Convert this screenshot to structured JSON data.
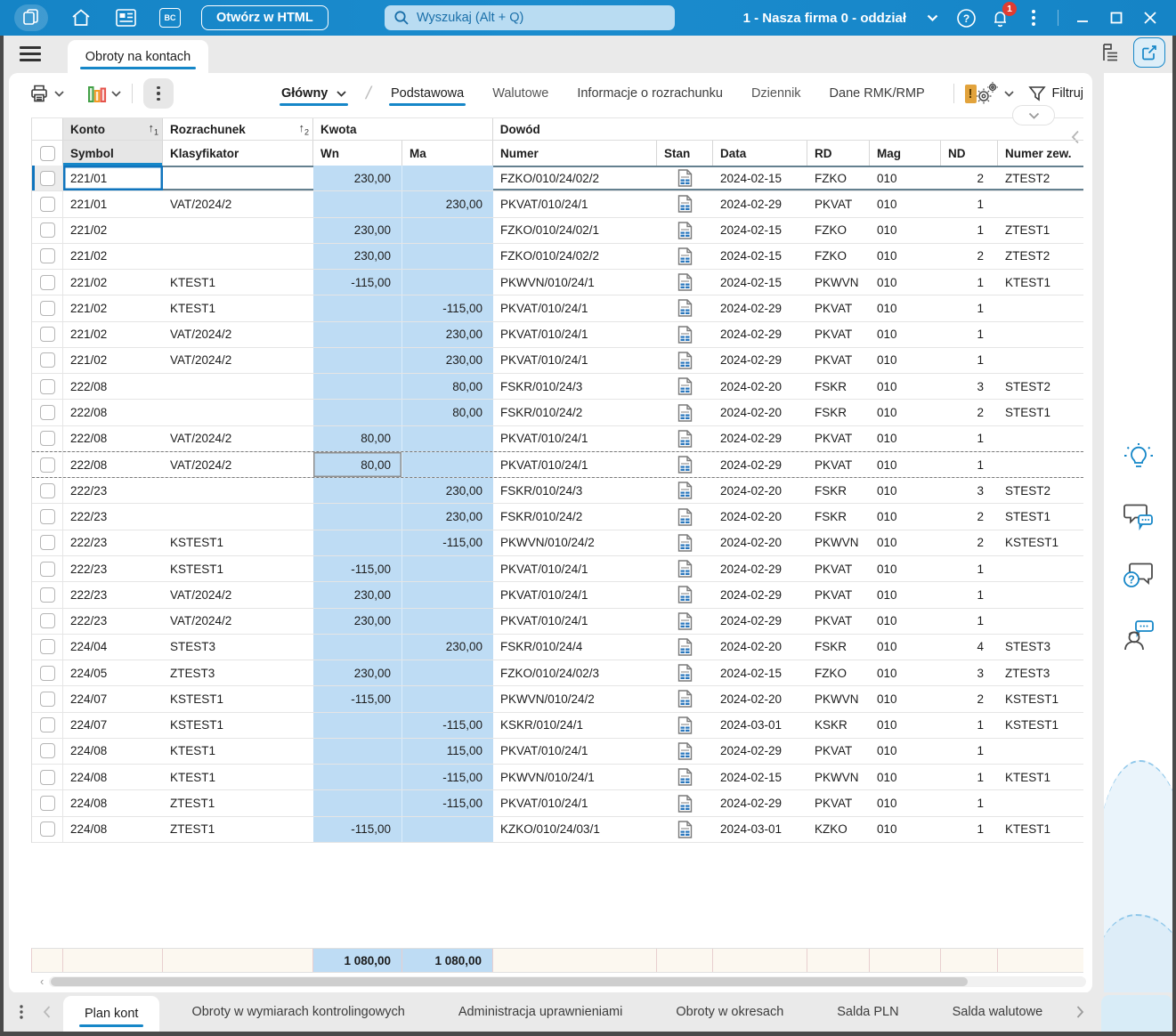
{
  "colors": {
    "accent": "#1687c8",
    "amount_highlight": "#bedcf4",
    "warning_badge": "#e2a33c",
    "notification_badge": "#e03c31",
    "totals_bg": "#fcf8f0"
  },
  "titlebar": {
    "open_html_label": "Otwórz w HTML",
    "search_placeholder": "Wyszukaj (Alt + Q)",
    "company_selector": "1 - Nasza firma 0 - oddział",
    "notification_count": "1"
  },
  "tabstrip": {
    "document_tab": "Obroty na kontach"
  },
  "toolbar": {
    "views": [
      {
        "label": "Główny"
      },
      {
        "label": "Podstawowa"
      },
      {
        "label": "Walutowe"
      },
      {
        "label": "Informacje o rozrachunku"
      },
      {
        "label": "Dziennik"
      },
      {
        "label": "Dane RMK/RMP"
      }
    ],
    "filter_label": "Filtruj"
  },
  "table": {
    "group_headers": {
      "konto": "Konto",
      "rozrachunek": "Rozrachunek",
      "kwota": "Kwota",
      "dowod": "Dowód"
    },
    "sort": {
      "konto": "1",
      "rozrachunek": "2"
    },
    "columns": {
      "symbol": "Symbol",
      "klasyfikator": "Klasyfikator",
      "wn": "Wn",
      "ma": "Ma",
      "numer": "Numer",
      "stan": "Stan",
      "data": "Data",
      "rd": "RD",
      "mag": "Mag",
      "nd": "ND",
      "zew": "Numer zew."
    },
    "stan_icon": "document-icon",
    "rows": [
      {
        "sym": "221/01",
        "kla": "",
        "wn": "230,00",
        "ma": "",
        "num": "FZKO/010/24/02/2",
        "date": "2024-02-15",
        "rd": "FZKO",
        "mag": "010",
        "nd": "2",
        "zew": "ZTEST2",
        "active": true
      },
      {
        "sym": "221/01",
        "kla": "VAT/2024/2",
        "wn": "",
        "ma": "230,00",
        "num": "PKVAT/010/24/1",
        "date": "2024-02-29",
        "rd": "PKVAT",
        "mag": "010",
        "nd": "1",
        "zew": ""
      },
      {
        "sym": "221/02",
        "kla": "",
        "wn": "230,00",
        "ma": "",
        "num": "FZKO/010/24/02/1",
        "date": "2024-02-15",
        "rd": "FZKO",
        "mag": "010",
        "nd": "1",
        "zew": "ZTEST1"
      },
      {
        "sym": "221/02",
        "kla": "",
        "wn": "230,00",
        "ma": "",
        "num": "FZKO/010/24/02/2",
        "date": "2024-02-15",
        "rd": "FZKO",
        "mag": "010",
        "nd": "2",
        "zew": "ZTEST2"
      },
      {
        "sym": "221/02",
        "kla": "KTEST1",
        "wn": "-115,00",
        "ma": "",
        "num": "PKWVN/010/24/1",
        "date": "2024-02-15",
        "rd": "PKWVN",
        "mag": "010",
        "nd": "1",
        "zew": "KTEST1"
      },
      {
        "sym": "221/02",
        "kla": "KTEST1",
        "wn": "",
        "ma": "-115,00",
        "num": "PKVAT/010/24/1",
        "date": "2024-02-29",
        "rd": "PKVAT",
        "mag": "010",
        "nd": "1",
        "zew": ""
      },
      {
        "sym": "221/02",
        "kla": "VAT/2024/2",
        "wn": "",
        "ma": "230,00",
        "num": "PKVAT/010/24/1",
        "date": "2024-02-29",
        "rd": "PKVAT",
        "mag": "010",
        "nd": "1",
        "zew": ""
      },
      {
        "sym": "221/02",
        "kla": "VAT/2024/2",
        "wn": "",
        "ma": "230,00",
        "num": "PKVAT/010/24/1",
        "date": "2024-02-29",
        "rd": "PKVAT",
        "mag": "010",
        "nd": "1",
        "zew": ""
      },
      {
        "sym": "222/08",
        "kla": "",
        "wn": "",
        "ma": "80,00",
        "num": "FSKR/010/24/3",
        "date": "2024-02-20",
        "rd": "FSKR",
        "mag": "010",
        "nd": "3",
        "zew": "STEST2"
      },
      {
        "sym": "222/08",
        "kla": "",
        "wn": "",
        "ma": "80,00",
        "num": "FSKR/010/24/2",
        "date": "2024-02-20",
        "rd": "FSKR",
        "mag": "010",
        "nd": "2",
        "zew": "STEST1"
      },
      {
        "sym": "222/08",
        "kla": "VAT/2024/2",
        "wn": "80,00",
        "ma": "",
        "num": "PKVAT/010/24/1",
        "date": "2024-02-29",
        "rd": "PKVAT",
        "mag": "010",
        "nd": "1",
        "zew": ""
      },
      {
        "sym": "222/08",
        "kla": "VAT/2024/2",
        "wn": "80,00",
        "ma": "",
        "num": "PKVAT/010/24/1",
        "date": "2024-02-29",
        "rd": "PKVAT",
        "mag": "010",
        "nd": "1",
        "zew": "",
        "cursor": true
      },
      {
        "sym": "222/23",
        "kla": "",
        "wn": "",
        "ma": "230,00",
        "num": "FSKR/010/24/3",
        "date": "2024-02-20",
        "rd": "FSKR",
        "mag": "010",
        "nd": "3",
        "zew": "STEST2"
      },
      {
        "sym": "222/23",
        "kla": "",
        "wn": "",
        "ma": "230,00",
        "num": "FSKR/010/24/2",
        "date": "2024-02-20",
        "rd": "FSKR",
        "mag": "010",
        "nd": "2",
        "zew": "STEST1"
      },
      {
        "sym": "222/23",
        "kla": "KSTEST1",
        "wn": "",
        "ma": "-115,00",
        "num": "PKWVN/010/24/2",
        "date": "2024-02-20",
        "rd": "PKWVN",
        "mag": "010",
        "nd": "2",
        "zew": "KSTEST1"
      },
      {
        "sym": "222/23",
        "kla": "KSTEST1",
        "wn": "-115,00",
        "ma": "",
        "num": "PKVAT/010/24/1",
        "date": "2024-02-29",
        "rd": "PKVAT",
        "mag": "010",
        "nd": "1",
        "zew": ""
      },
      {
        "sym": "222/23",
        "kla": "VAT/2024/2",
        "wn": "230,00",
        "ma": "",
        "num": "PKVAT/010/24/1",
        "date": "2024-02-29",
        "rd": "PKVAT",
        "mag": "010",
        "nd": "1",
        "zew": ""
      },
      {
        "sym": "222/23",
        "kla": "VAT/2024/2",
        "wn": "230,00",
        "ma": "",
        "num": "PKVAT/010/24/1",
        "date": "2024-02-29",
        "rd": "PKVAT",
        "mag": "010",
        "nd": "1",
        "zew": ""
      },
      {
        "sym": "224/04",
        "kla": "STEST3",
        "wn": "",
        "ma": "230,00",
        "num": "FSKR/010/24/4",
        "date": "2024-02-20",
        "rd": "FSKR",
        "mag": "010",
        "nd": "4",
        "zew": "STEST3"
      },
      {
        "sym": "224/05",
        "kla": "ZTEST3",
        "wn": "230,00",
        "ma": "",
        "num": "FZKO/010/24/02/3",
        "date": "2024-02-15",
        "rd": "FZKO",
        "mag": "010",
        "nd": "3",
        "zew": "ZTEST3"
      },
      {
        "sym": "224/07",
        "kla": "KSTEST1",
        "wn": "-115,00",
        "ma": "",
        "num": "PKWVN/010/24/2",
        "date": "2024-02-20",
        "rd": "PKWVN",
        "mag": "010",
        "nd": "2",
        "zew": "KSTEST1"
      },
      {
        "sym": "224/07",
        "kla": "KSTEST1",
        "wn": "",
        "ma": "-115,00",
        "num": "KSKR/010/24/1",
        "date": "2024-03-01",
        "rd": "KSKR",
        "mag": "010",
        "nd": "1",
        "zew": "KSTEST1"
      },
      {
        "sym": "224/08",
        "kla": "KTEST1",
        "wn": "",
        "ma": "115,00",
        "num": "PKVAT/010/24/1",
        "date": "2024-02-29",
        "rd": "PKVAT",
        "mag": "010",
        "nd": "1",
        "zew": ""
      },
      {
        "sym": "224/08",
        "kla": "KTEST1",
        "wn": "",
        "ma": "-115,00",
        "num": "PKWVN/010/24/1",
        "date": "2024-02-15",
        "rd": "PKWVN",
        "mag": "010",
        "nd": "1",
        "zew": "KTEST1"
      },
      {
        "sym": "224/08",
        "kla": "ZTEST1",
        "wn": "",
        "ma": "-115,00",
        "num": "PKVAT/010/24/1",
        "date": "2024-02-29",
        "rd": "PKVAT",
        "mag": "010",
        "nd": "1",
        "zew": ""
      },
      {
        "sym": "224/08",
        "kla": "ZTEST1",
        "wn": "-115,00",
        "ma": "",
        "num": "KZKO/010/24/03/1",
        "date": "2024-03-01",
        "rd": "KZKO",
        "mag": "010",
        "nd": "1",
        "zew": "KTEST1"
      }
    ],
    "totals": {
      "wn": "1 080,00",
      "ma": "1 080,00"
    }
  },
  "bottombar": {
    "tabs": [
      {
        "label": "Plan kont",
        "active": true
      },
      {
        "label": "Obroty w wymiarach kontrolingowych"
      },
      {
        "label": "Administracja uprawnieniami"
      },
      {
        "label": "Obroty w okresach"
      },
      {
        "label": "Salda PLN"
      },
      {
        "label": "Salda walutowe"
      }
    ]
  }
}
